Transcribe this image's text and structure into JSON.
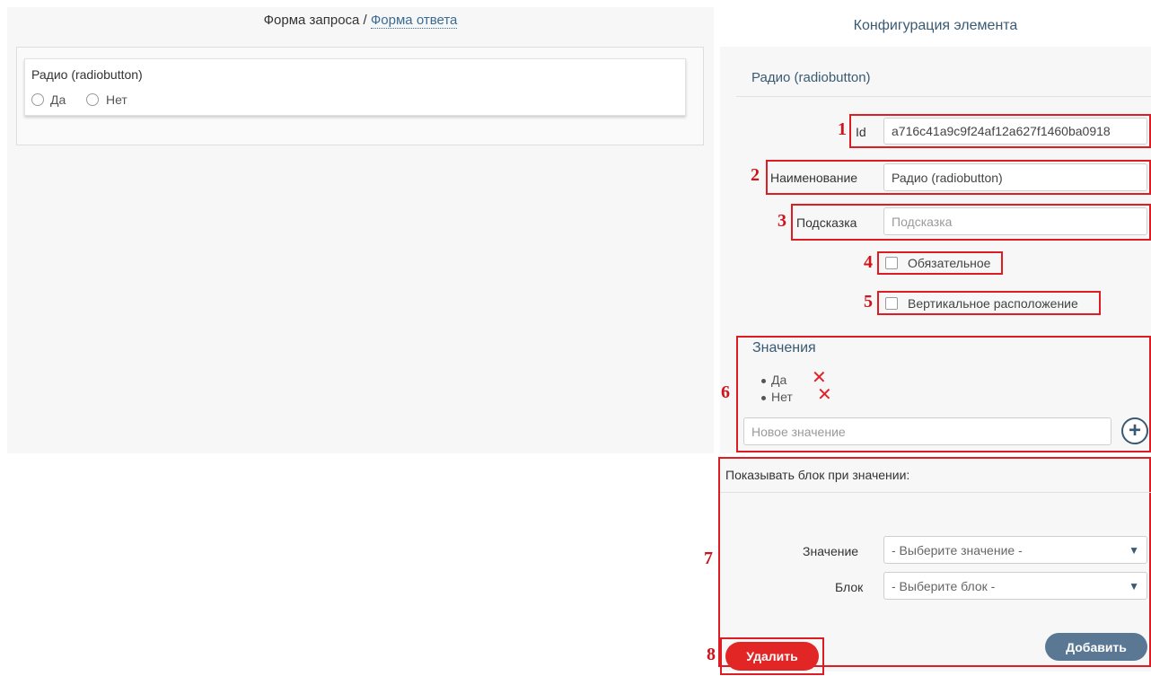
{
  "left": {
    "header_part1": "Форма запроса /",
    "header_link": "Форма ответа",
    "element_title": "Радио (radiobutton)",
    "options": [
      "Да",
      "Нет"
    ]
  },
  "right": {
    "header": "Конфигурация элемента",
    "element_title": "Радио (radiobutton)",
    "fields": {
      "id_label": "Id",
      "id_value": "a716c41a9c9f24af12a627f1460ba0918",
      "name_label": "Наименование",
      "name_value": "Радио (radiobutton)",
      "hint_label": "Подсказка",
      "hint_placeholder": "Подсказка",
      "required_label": "Обязательное",
      "vertical_label": "Вертикальное расположение"
    },
    "values": {
      "title": "Значения",
      "items": [
        "Да",
        "Нет"
      ],
      "new_placeholder": "Новое значение"
    },
    "show_block": {
      "title": "Показывать блок при значении:",
      "value_label": "Значение",
      "value_select": "- Выберите значение -",
      "block_label": "Блок",
      "block_select": "- Выберите блок -",
      "add_button": "Добавить"
    },
    "delete_button": "Удалить"
  },
  "annotations": [
    "1",
    "2",
    "3",
    "4",
    "5",
    "6",
    "7",
    "8"
  ],
  "colors": {
    "annotation_red": "#dd1c23",
    "accent_blue": "#3a5a74",
    "delete_red": "#e22525",
    "add_button": "#5a7893"
  }
}
